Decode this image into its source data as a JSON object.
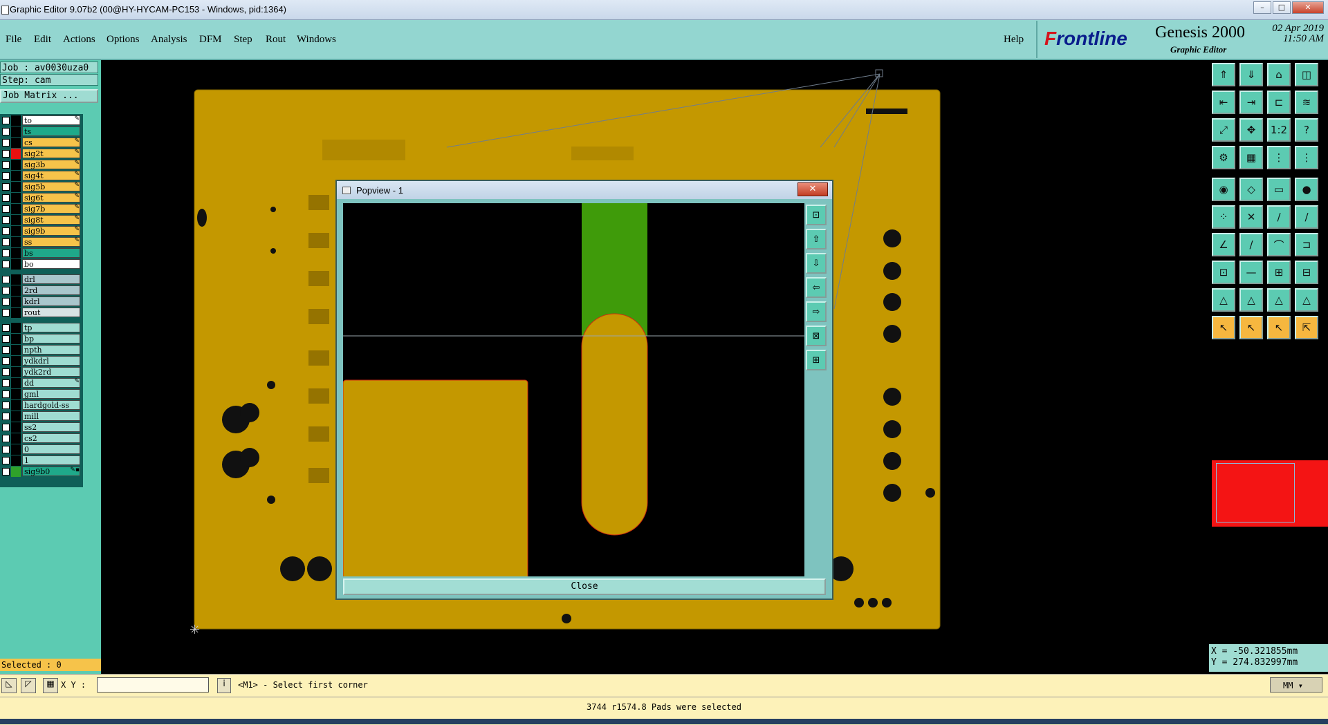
{
  "window": {
    "title": "Graphic Editor 9.07b2 (00@HY-HYCAM-PC153 - Windows, pid:1364)",
    "min": "–",
    "max": "□",
    "close": "✕"
  },
  "menu": {
    "items": [
      "File",
      "Edit",
      "Actions",
      "Options",
      "Analysis",
      "DFM",
      "Step",
      "Rout",
      "Windows"
    ],
    "help": "Help"
  },
  "brand": {
    "logo_f": "F",
    "logo_rest": "rontline",
    "product": "Genesis 2000",
    "subtitle": "Graphic Editor",
    "date": "02 Apr 2019",
    "time": "11:50 AM"
  },
  "job": {
    "job_label": "Job : av0030uza0",
    "step_label": "Step: cam",
    "matrix_button": "Job Matrix ..."
  },
  "layers": [
    {
      "name": "to",
      "bg": "#ffffff",
      "swatch": "#000000",
      "edit": "✎"
    },
    {
      "name": "ts",
      "bg": "#1fa98a",
      "swatch": "#000000",
      "edit": ""
    },
    {
      "name": "cs",
      "bg": "#f6c34a",
      "swatch": "#000000",
      "edit": "✎"
    },
    {
      "name": "sig2t",
      "bg": "#f6c34a",
      "swatch": "#e81010",
      "edit": "✎"
    },
    {
      "name": "sig3b",
      "bg": "#f6c34a",
      "swatch": "#000000",
      "edit": "✎"
    },
    {
      "name": "sig4t",
      "bg": "#f6c34a",
      "swatch": "#000000",
      "edit": "✎"
    },
    {
      "name": "sig5b",
      "bg": "#f6c34a",
      "swatch": "#000000",
      "edit": "✎"
    },
    {
      "name": "sig6t",
      "bg": "#f6c34a",
      "swatch": "#000000",
      "edit": "✎"
    },
    {
      "name": "sig7b",
      "bg": "#f6c34a",
      "swatch": "#000000",
      "edit": "✎"
    },
    {
      "name": "sig8t",
      "bg": "#f6c34a",
      "swatch": "#000000",
      "edit": "✎"
    },
    {
      "name": "sig9b",
      "bg": "#f6c34a",
      "swatch": "#000000",
      "edit": "✎"
    },
    {
      "name": "ss",
      "bg": "#f6c34a",
      "swatch": "#000000",
      "edit": "✎"
    },
    {
      "name": "bs",
      "bg": "#1fa98a",
      "swatch": "#000000",
      "edit": ""
    },
    {
      "name": "bo",
      "bg": "#ffffff",
      "swatch": "#000000",
      "edit": ""
    },
    {
      "name": "drl",
      "bg": "#a9c6cc",
      "swatch": "#000000",
      "edit": ""
    },
    {
      "name": "2rd",
      "bg": "#a9c6cc",
      "swatch": "#000000",
      "edit": ""
    },
    {
      "name": "kdrl",
      "bg": "#a9c6cc",
      "swatch": "#000000",
      "edit": ""
    },
    {
      "name": "rout",
      "bg": "#d8e2e4",
      "swatch": "#000000",
      "edit": ""
    },
    {
      "name": "tp",
      "bg": "#9fdcd2",
      "swatch": "#000000",
      "edit": ""
    },
    {
      "name": "bp",
      "bg": "#9fdcd2",
      "swatch": "#000000",
      "edit": ""
    },
    {
      "name": "npth",
      "bg": "#9fdcd2",
      "swatch": "#000000",
      "edit": ""
    },
    {
      "name": "ydkdrl",
      "bg": "#9fdcd2",
      "swatch": "#000000",
      "edit": ""
    },
    {
      "name": "ydk2rd",
      "bg": "#9fdcd2",
      "swatch": "#000000",
      "edit": ""
    },
    {
      "name": "dd",
      "bg": "#9fdcd2",
      "swatch": "#000000",
      "edit": "✎"
    },
    {
      "name": "gml",
      "bg": "#9fdcd2",
      "swatch": "#000000",
      "edit": ""
    },
    {
      "name": "hardgold-ss",
      "bg": "#9fdcd2",
      "swatch": "#000000",
      "edit": ""
    },
    {
      "name": "mill",
      "bg": "#9fdcd2",
      "swatch": "#000000",
      "edit": ""
    },
    {
      "name": "ss2",
      "bg": "#9fdcd2",
      "swatch": "#000000",
      "edit": ""
    },
    {
      "name": "cs2",
      "bg": "#9fdcd2",
      "swatch": "#000000",
      "edit": ""
    },
    {
      "name": "0",
      "bg": "#9fdcd2",
      "swatch": "#000000",
      "edit": ""
    },
    {
      "name": "1",
      "bg": "#9fdcd2",
      "swatch": "#000000",
      "edit": ""
    },
    {
      "name": "sig9b0",
      "bg": "#1fa98a",
      "swatch": "#2fa22a",
      "edit": "✎▪"
    }
  ],
  "selected_text": "Selected : 0",
  "popview": {
    "title": "Popview - 1",
    "close_x": "✕",
    "close_button": "Close",
    "side_buttons": [
      "⊡",
      "⇧",
      "⇩",
      "⇦",
      "⇨",
      "⊠",
      "⊞"
    ]
  },
  "toolbox": {
    "rows": [
      [
        "⇑",
        "⇓",
        "⌂",
        "◫"
      ],
      [
        "⇤",
        "⇥",
        "⊏",
        "≋"
      ],
      [
        "⤢",
        "✥",
        "1:2",
        "?"
      ],
      [
        "⚙",
        "▦",
        "⋮",
        "⋮"
      ],
      [
        "◉",
        "◇",
        "▭",
        "●"
      ],
      [
        "⁘",
        "✕",
        "∕",
        "∕"
      ],
      [
        "∠",
        "∕",
        "⌒",
        "⊐"
      ],
      [
        "⊡",
        "—",
        "⊞",
        "⊟"
      ],
      [
        "△",
        "△",
        "△",
        "△"
      ],
      [
        "↖",
        "↖",
        "↖",
        "⇱"
      ]
    ]
  },
  "coords": {
    "x": "X = -50.321855mm",
    "y": "Y = 274.832997mm"
  },
  "cmdbar": {
    "xy_label": "X Y :",
    "xy_value": "",
    "prompt": "<M1> - Select first corner",
    "units": "MM"
  },
  "status": "3744 r1574.8 Pads were selected",
  "colors": {
    "board": "#c49800",
    "trace_green": "#3f9b0a",
    "panel": "#5ccbb2",
    "menubar": "#93d6d0",
    "status_yellow": "#fdf2b9"
  }
}
